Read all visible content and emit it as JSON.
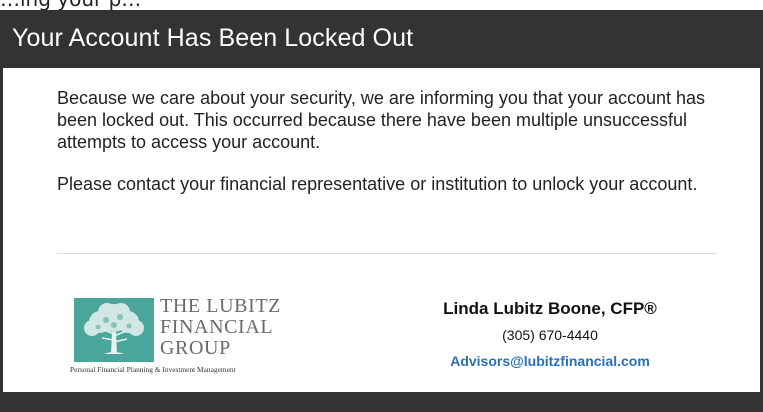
{
  "clipped_top_text": "…ing your p…",
  "header": {
    "title": "Your Account Has Been Locked Out"
  },
  "message": {
    "paragraph_1": "Because we care about your security, we are informing you that your account has been locked out. This occurred because there have been multiple unsuccessful attempts to access your account.",
    "paragraph_2": "Please contact your financial representative or institution to unlock your account."
  },
  "logo": {
    "line_1": "THE LUBITZ",
    "line_2": "FINANCIAL",
    "line_3": "GROUP",
    "tagline": "Personal Financial Planning & Investment Management",
    "mark_color": "#4aa59a",
    "icon": "tree-icon"
  },
  "contact": {
    "name": "Linda Lubitz Boone, CFP®",
    "phone": "(305) 670-4440",
    "email": "Advisors@lubitzfinancial.com"
  },
  "colors": {
    "header_bg": "#333333",
    "link": "#2b6fb3"
  }
}
